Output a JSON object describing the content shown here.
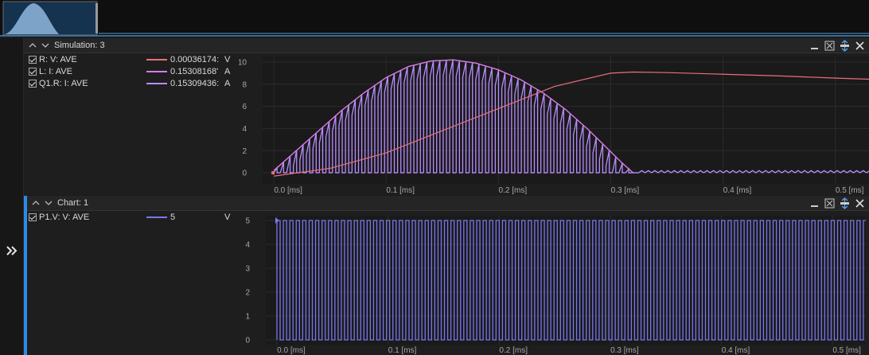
{
  "colors": {
    "resistor_voltage": "#e9707a",
    "inductor_current": "#d97be8",
    "q1_current": "#b88cff",
    "p1_voltage": "#7a76ee",
    "accent": "#2b8ce6"
  },
  "overview": {
    "icon": "waveform-overview"
  },
  "left_rail": {
    "expand_icon": "double-chevron-right-icon"
  },
  "panels": [
    {
      "title": "Simulation: 3",
      "legend": [
        {
          "name": "R: V: AVE",
          "value": "0.00036174:",
          "unit": "V",
          "checked": true
        },
        {
          "name": "L: I: AVE",
          "value": "0.15308168'",
          "unit": "A",
          "checked": true
        },
        {
          "name": "Q1.R: I: AVE",
          "value": "0.15309436:",
          "unit": "A",
          "checked": true
        }
      ],
      "y_ticks": [
        "10",
        "8",
        "6",
        "4",
        "2",
        "0"
      ],
      "x_ticks": [
        "0.0 [ms]",
        "0.1 [ms]",
        "0.2 [ms]",
        "0.3 [ms]",
        "0.4 [ms]",
        "0.5 [ms]"
      ]
    },
    {
      "title": "Chart: 1",
      "legend": [
        {
          "name": "P1.V: V: AVE",
          "value": "5",
          "unit": "V",
          "checked": true
        }
      ],
      "y_ticks": [
        "5",
        "4",
        "3",
        "2",
        "1",
        "0"
      ],
      "x_ticks": [
        "0.0 [ms]",
        "0.1 [ms]",
        "0.2 [ms]",
        "0.3 [ms]",
        "0.4 [ms]",
        "0.5 [ms]"
      ]
    }
  ],
  "chart_data": [
    {
      "type": "line",
      "x_unit": "ms",
      "xlim": [
        -0.01,
        0.53
      ],
      "ylim": [
        -1,
        10.5
      ],
      "series": [
        {
          "name": "R: V: AVE",
          "x": [
            0.0,
            0.05,
            0.1,
            0.15,
            0.2,
            0.25,
            0.3,
            0.32,
            0.35,
            0.4,
            0.45,
            0.5,
            0.53
          ],
          "y": [
            -0.3,
            0.4,
            1.8,
            3.8,
            5.8,
            7.8,
            9.0,
            9.1,
            9.05,
            8.9,
            8.75,
            8.55,
            8.45
          ]
        },
        {
          "name": "L: I: AVE",
          "x": [
            0.0,
            0.02,
            0.04,
            0.06,
            0.08,
            0.1,
            0.12,
            0.14,
            0.16,
            0.18,
            0.2,
            0.22,
            0.24,
            0.26,
            0.28,
            0.3,
            0.31,
            0.32
          ],
          "y": [
            0.2,
            2.0,
            3.8,
            5.6,
            7.2,
            8.6,
            9.6,
            10.1,
            10.2,
            9.9,
            9.3,
            8.4,
            7.2,
            5.7,
            3.9,
            1.9,
            0.9,
            0
          ]
        },
        {
          "name": "Q1.R: I: AVE",
          "period_ms": 0.0058,
          "envelope": "L: I: AVE",
          "after_ms": 0.32,
          "ripple_peak": 0.2
        }
      ]
    },
    {
      "type": "line",
      "x_unit": "ms",
      "xlim": [
        -0.01,
        0.53
      ],
      "ylim": [
        -0.2,
        5.2
      ],
      "series": [
        {
          "name": "P1.V: V: AVE",
          "square_wave": true,
          "low": 0,
          "high": 5,
          "period_ms": 0.0058,
          "start_ms": 0.0
        }
      ]
    }
  ]
}
